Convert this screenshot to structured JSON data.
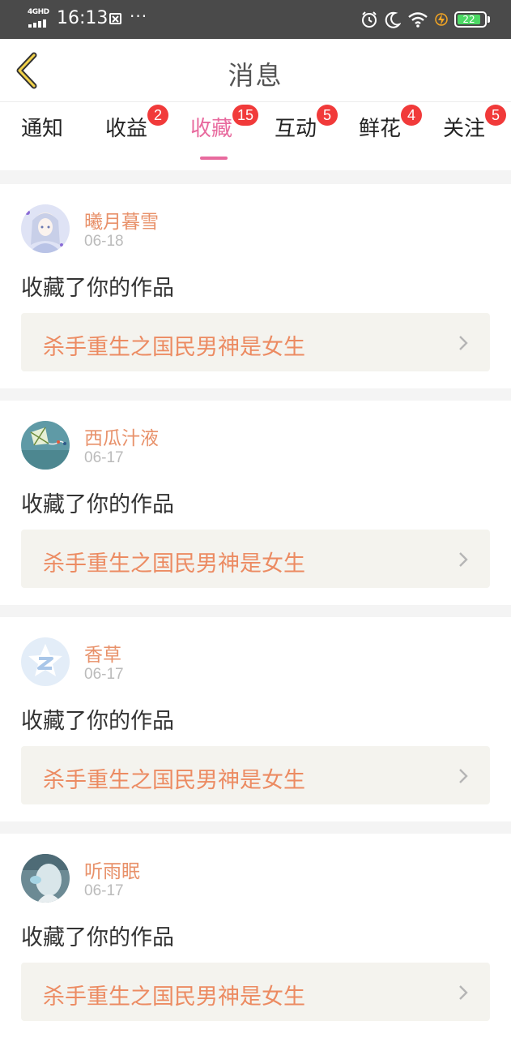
{
  "status_bar": {
    "network": "4GHD",
    "time": "16:13",
    "more": "···",
    "battery": "22"
  },
  "header": {
    "title": "消息"
  },
  "tabs": [
    {
      "label": "通知",
      "badge": ""
    },
    {
      "label": "收益",
      "badge": "2"
    },
    {
      "label": "收藏",
      "badge": "15",
      "active": true
    },
    {
      "label": "互动",
      "badge": "5"
    },
    {
      "label": "鲜花",
      "badge": "4"
    },
    {
      "label": "关注",
      "badge": "5"
    }
  ],
  "colors": {
    "accent": "#e86a9e",
    "badge": "#f13a3a",
    "username": "#e8916a",
    "work_title": "#ec8b62",
    "work_bg": "#f4f3ee"
  },
  "messages": [
    {
      "username": "曦月暮雪",
      "date": "06-18",
      "action": "收藏了你的作品",
      "work_title": "杀手重生之国民男神是女生",
      "avatar_icon": "anime-avatar"
    },
    {
      "username": "西瓜汁液",
      "date": "06-17",
      "action": "收藏了你的作品",
      "work_title": "杀手重生之国民男神是女生",
      "avatar_icon": "kite-avatar"
    },
    {
      "username": "香草",
      "date": "06-17",
      "action": "收藏了你的作品",
      "work_title": "杀手重生之国民男神是女生",
      "avatar_icon": "default-star-avatar"
    },
    {
      "username": "听雨眠",
      "date": "06-17",
      "action": "收藏了你的作品",
      "work_title": "杀手重生之国民男神是女生",
      "avatar_icon": "photo-avatar"
    }
  ]
}
